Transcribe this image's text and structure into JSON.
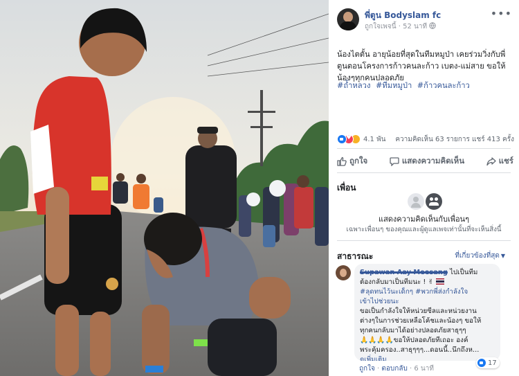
{
  "post": {
    "page_name": "พี่ตูน Bodyslam fc",
    "like_page": "ถูกใจเพจนี้",
    "dot": "·",
    "time": "52 นาที",
    "menu": "•••",
    "text": "น้องไตตั้น อายุน้อยที่สุดในทีมหมูป่า เคยร่วมวิ่งกับพี่ตูนตอนโครงการก้าวคนละก้าว เบตง-แม่สาย ขอให้น้องๆทุกคนปลอดภัย",
    "hashtags": [
      "#ถ้ำหลวง",
      "#ทีมหมูป่า",
      "#ก้าวคนละก้าว"
    ],
    "reactions": {
      "count": "4.1 พัน",
      "stats": "ความคิดเห็น 63 รายการ  แชร์ 413 ครั้ง"
    },
    "actions": {
      "like": "ถูกใจ",
      "comment": "แสดงความคิดเห็น",
      "share": "แชร์"
    }
  },
  "friends": {
    "heading": "เพื่อน",
    "message": "แสดงความคิดเห็นกับเพื่อนๆ",
    "subtext": "เฉพาะเพื่อนๆ ของคุณและผู้ดูแลเพจเท่านั้นที่จะเห็นสิ่งนี้"
  },
  "public": {
    "heading": "สาธารณะ",
    "sort": "ที่เกี่ยวข้องที่สุด",
    "comment": {
      "author": "Supawan Aay Meesang",
      "line1": "ไปเป็นทีม",
      "line2": "ต้องกลับมาเป็นทีมนะ !",
      "hashtags": "#ลุดทนไว้นะเด็กๆ #พวกพี่ส่งกำลังใจ",
      "hashtags2": "เข้าไปช่วยนะ",
      "body1": "ขอเป็นกำลังใจให้หน่วยซีลและหน่วยงาน",
      "body2": "ต่างๆในการช่วยเหลือโค้ชและน้องๆ ขอให้",
      "body3": "ทุกคนกลับมาได้อย่างปลอดภัยสาธุๆๆ",
      "body4": "🙏🙏🙏🙏ขอให้ปลอดภัยทีเถอะ องค์",
      "body5": "พระคุ้มครอง..สาธุๆๆๆ...ดอนนี้..นึกถึงห...",
      "see_more": "ดูเพิ่มเติม",
      "like": "ถูกใจ",
      "reply": "ตอบกลับ",
      "time": "6 นาที",
      "likes": "17"
    }
  },
  "colors": {
    "link": "#365899",
    "like_blue": "#1877f2",
    "muted": "#606770"
  }
}
